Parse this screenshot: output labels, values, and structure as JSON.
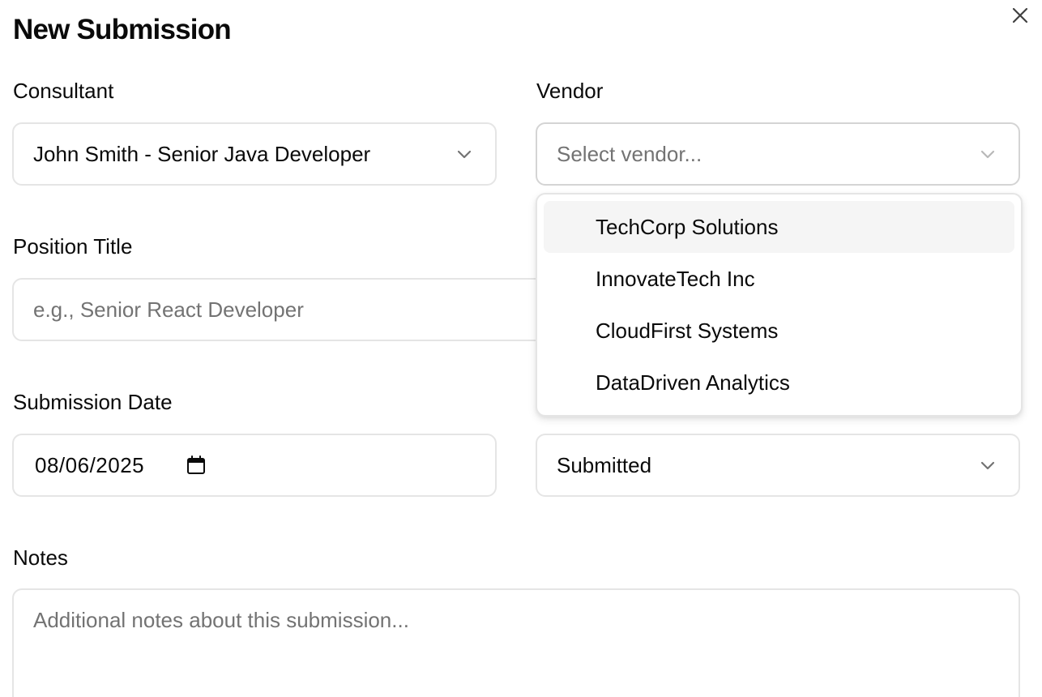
{
  "dialog": {
    "title": "New Submission",
    "close_icon": "close-icon"
  },
  "form": {
    "consultant": {
      "label": "Consultant",
      "value": "John Smith - Senior Java Developer"
    },
    "vendor": {
      "label": "Vendor",
      "placeholder": "Select vendor..."
    },
    "position_title": {
      "label": "Position Title",
      "placeholder": "e.g., Senior React Developer"
    },
    "submission_date": {
      "label": "Submission Date",
      "value": "08/06/2025",
      "icon": "calendar-icon"
    },
    "status": {
      "value": "Submitted"
    },
    "notes": {
      "label": "Notes",
      "placeholder": "Additional notes about this submission..."
    }
  },
  "vendor_dropdown": {
    "highlighted_index": 0,
    "options": [
      {
        "label": "TechCorp Solutions"
      },
      {
        "label": "InnovateTech Inc"
      },
      {
        "label": "CloudFirst Systems"
      },
      {
        "label": "DataDriven Analytics"
      }
    ]
  },
  "colors": {
    "text": "#0a0a0a",
    "placeholder": "#737373",
    "border": "#e5e5e5",
    "highlight": "#f5f5f5"
  }
}
